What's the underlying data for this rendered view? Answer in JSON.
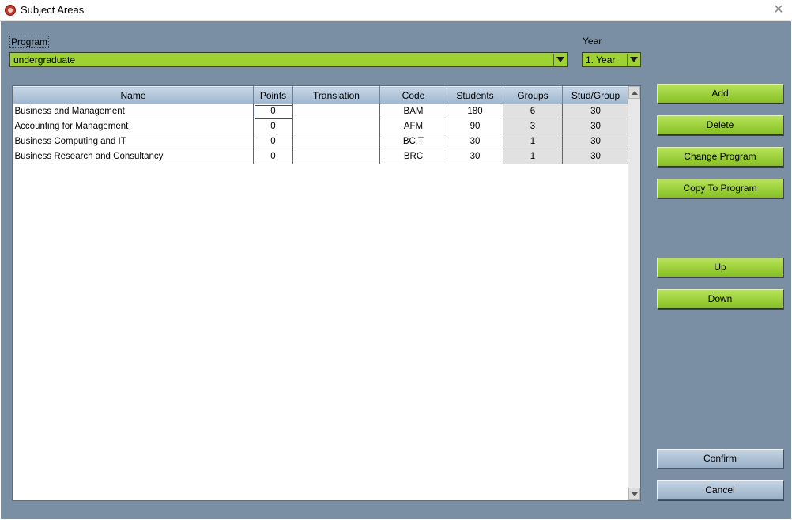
{
  "window": {
    "title": "Subject Areas",
    "close_glyph": "✕"
  },
  "program": {
    "label": "Program",
    "value": "undergraduate"
  },
  "year": {
    "label": "Year",
    "value": "1. Year"
  },
  "table": {
    "columns": [
      "Name",
      "Points",
      "Translation",
      "Code",
      "Students",
      "Groups",
      "Stud/Group"
    ],
    "rows": [
      [
        "Business and Management",
        "0",
        "",
        "BAM",
        "180",
        "6",
        "30"
      ],
      [
        "Accounting for Management",
        "0",
        "",
        "AFM",
        "90",
        "3",
        "30"
      ],
      [
        "Business Computing and IT",
        "0",
        "",
        "BCIT",
        "30",
        "1",
        "30"
      ],
      [
        "Business Research and Consultancy",
        "0",
        "",
        "BRC",
        "30",
        "1",
        "30"
      ]
    ]
  },
  "buttons": {
    "add": "Add",
    "delete": "Delete",
    "change_program": "Change Program",
    "copy_to_program": "Copy To Program",
    "up": "Up",
    "down": "Down",
    "confirm": "Confirm",
    "cancel": "Cancel"
  },
  "colors": {
    "background": "#7a8fa3",
    "accent_green": "#9ed233",
    "header_blue": "#b4c7db"
  }
}
